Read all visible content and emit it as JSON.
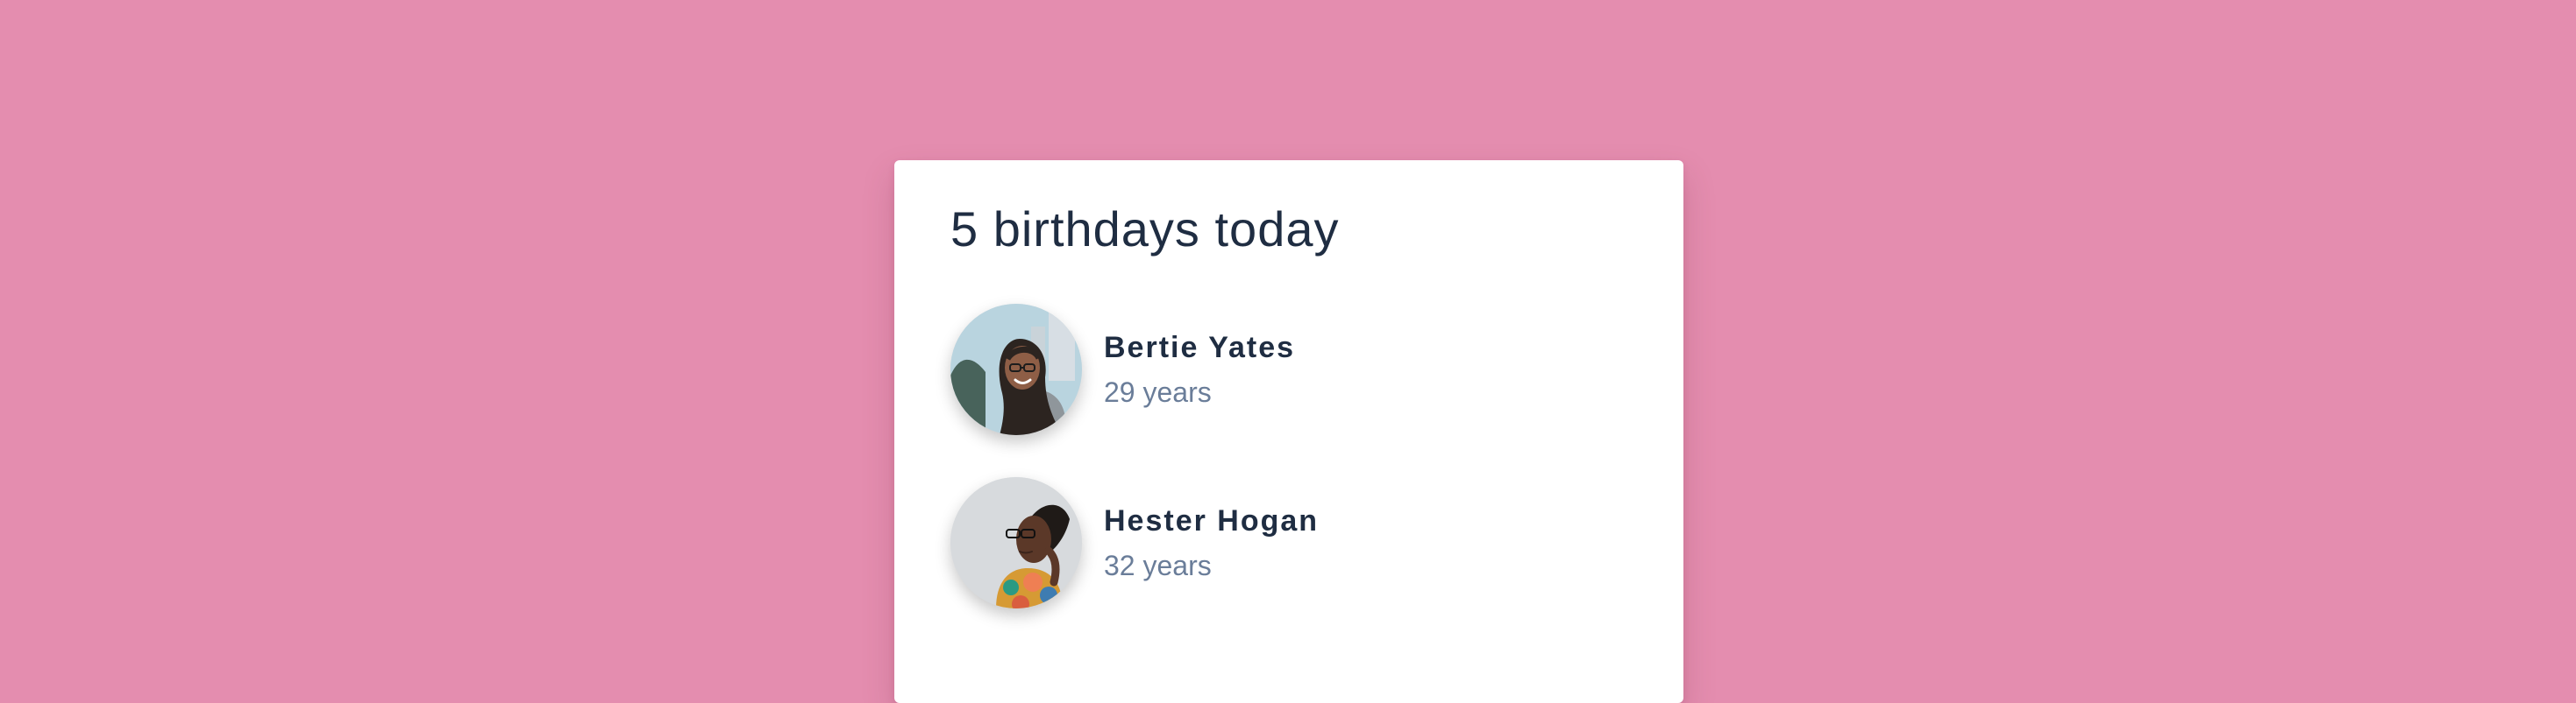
{
  "card": {
    "title": "5 birthdays today",
    "people": [
      {
        "name": "Bertie Yates",
        "age": "29 years",
        "avatar_icon": "person-photo-icon"
      },
      {
        "name": "Hester Hogan",
        "age": "32 years",
        "avatar_icon": "person-photo-icon"
      }
    ]
  },
  "colors": {
    "background": "#e48daf",
    "card": "#ffffff",
    "name_text": "#1f2d42",
    "age_text": "#6a7d99"
  }
}
